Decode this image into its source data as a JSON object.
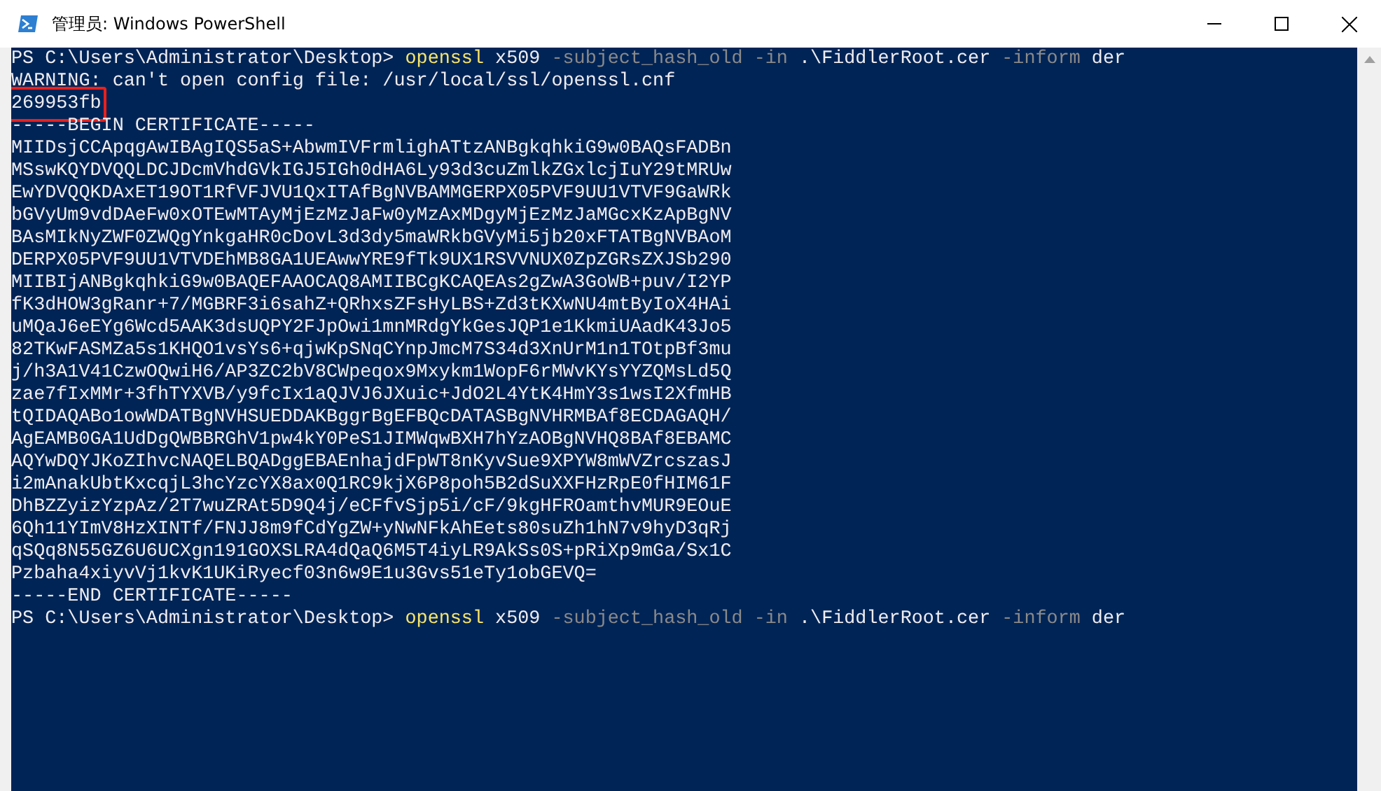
{
  "window": {
    "title": "管理员: Windows PowerShell"
  },
  "console": {
    "lines": [
      {
        "kind": "command",
        "prompt": "PS C:\\Users\\Administrator\\Desktop>",
        "tokens": [
          {
            "kind": "command",
            "text": "openssl"
          },
          {
            "kind": "argument",
            "text": "x509"
          },
          {
            "kind": "parameter",
            "text": "-subject_hash_old"
          },
          {
            "kind": "parameter",
            "text": "-in"
          },
          {
            "kind": "argument",
            "text": ".\\FiddlerRoot.cer"
          },
          {
            "kind": "parameter",
            "text": "-inform"
          },
          {
            "kind": "argument",
            "text": "der"
          }
        ]
      },
      {
        "kind": "output",
        "text": "WARNING: can't open config file: /usr/local/ssl/openssl.cnf"
      },
      {
        "kind": "output",
        "text": "269953fb",
        "highlighted": true
      },
      {
        "kind": "output",
        "text": "-----BEGIN CERTIFICATE-----"
      },
      {
        "kind": "output",
        "text": "MIIDsjCCApqgAwIBAgIQS5aS+AbwmIVFrmlighATtzANBgkqhkiG9w0BAQsFADBn"
      },
      {
        "kind": "output",
        "text": "MSswKQYDVQQLDCJDcmVhdGVkIGJ5IGh0dHA6Ly93d3cuZmlkZGxlcjIuY29tMRUw"
      },
      {
        "kind": "output",
        "text": "EwYDVQQKDAxET19OT1RfVFJVU1QxITAfBgNVBAMMGERPX05PVF9UU1VTVF9GaWRk"
      },
      {
        "kind": "output",
        "text": "bGVyUm9vdDAeFw0xOTEwMTAyMjEzMzJaFw0yMzAxMDgyMjEzMzJaMGcxKzApBgNV"
      },
      {
        "kind": "output",
        "text": "BAsMIkNyZWF0ZWQgYnkgaHR0cDovL3d3dy5maWRkbGVyMi5jb20xFTATBgNVBAoM"
      },
      {
        "kind": "output",
        "text": "DERPX05PVF9UU1VTVDEhMB8GA1UEAwwYRE9fTk9UX1RSVVNUX0ZpZGRsZXJSb290"
      },
      {
        "kind": "output",
        "text": "MIIBIjANBgkqhkiG9w0BAQEFAAOCAQ8AMIIBCgKCAQEAs2gZwA3GoWB+puv/I2YP"
      },
      {
        "kind": "output",
        "text": "fK3dHOW3gRanr+7/MGBRF3i6sahZ+QRhxsZFsHyLBS+Zd3tKXwNU4mtByIoX4HAi"
      },
      {
        "kind": "output",
        "text": "uMQaJ6eEYg6Wcd5AAK3dsUQPY2FJpOwi1mnMRdgYkGesJQP1e1KkmiUAadK43Jo5"
      },
      {
        "kind": "output",
        "text": "82TKwFASMZa5s1KHQO1vsYs6+qjwKpSNqCYnpJmcM7S34d3XnUrM1n1TOtpBf3mu"
      },
      {
        "kind": "output",
        "text": "j/h3A1V41CzwOQwiH6/AP3ZC2bV8CWpeqox9Mxykm1WopF6rMWvKYsYYZQMsLd5Q"
      },
      {
        "kind": "output",
        "text": "zae7fIxMMr+3fhTYXVB/y9fcIx1aQJVJ6JXuic+JdO2L4YtK4HmY3s1wsI2XfmHB"
      },
      {
        "kind": "output",
        "text": "tQIDAQABo1owWDATBgNVHSUEDDAKBggrBgEFBQcDATASBgNVHRMBAf8ECDAGAQH/"
      },
      {
        "kind": "output",
        "text": "AgEAMB0GA1UdDgQWBBRGhV1pw4kY0PeS1JIMWqwBXH7hYzAOBgNVHQ8BAf8EBAMC"
      },
      {
        "kind": "output",
        "text": "AQYwDQYJKoZIhvcNAQELBQADggEBAEnhajdFpWT8nKyvSue9XPYW8mWVZrcszasJ"
      },
      {
        "kind": "output",
        "text": "i2mAnakUbtKxcqjL3hcYzcYX8ax0Q1RC9kjX6P8poh5B2dSuXXFHzRpE0fHIM61F"
      },
      {
        "kind": "output",
        "text": "DhBZZyizYzpAz/2T7wuZRAt5D9Q4j/eCFfvSjp5i/cF/9kgHFROamthvMUR9EOuE"
      },
      {
        "kind": "output",
        "text": "6Qh11YImV8HzXINTf/FNJJ8m9fCdYgZW+yNwNFkAhEets80suZh1hN7v9hyD3qRj"
      },
      {
        "kind": "output",
        "text": "qSQq8N55GZ6U6UCXgn191GOXSLRA4dQaQ6M5T4iyLR9AkSs0S+pRiXp9mGa/Sx1C"
      },
      {
        "kind": "output",
        "text": "Pzbaha4xiyvVj1kvK1UKiRyecf03n6w9E1u3Gvs51eTy1obGEVQ="
      },
      {
        "kind": "output",
        "text": "-----END CERTIFICATE-----"
      },
      {
        "kind": "command",
        "prompt": "PS C:\\Users\\Administrator\\Desktop>",
        "tokens": [
          {
            "kind": "command",
            "text": "openssl"
          },
          {
            "kind": "argument",
            "text": "x509"
          },
          {
            "kind": "parameter",
            "text": "-subject_hash_old"
          },
          {
            "kind": "parameter",
            "text": "-in"
          },
          {
            "kind": "argument",
            "text": ".\\FiddlerRoot.cer"
          },
          {
            "kind": "parameter",
            "text": "-inform"
          },
          {
            "kind": "argument",
            "text": "der"
          }
        ]
      }
    ]
  }
}
